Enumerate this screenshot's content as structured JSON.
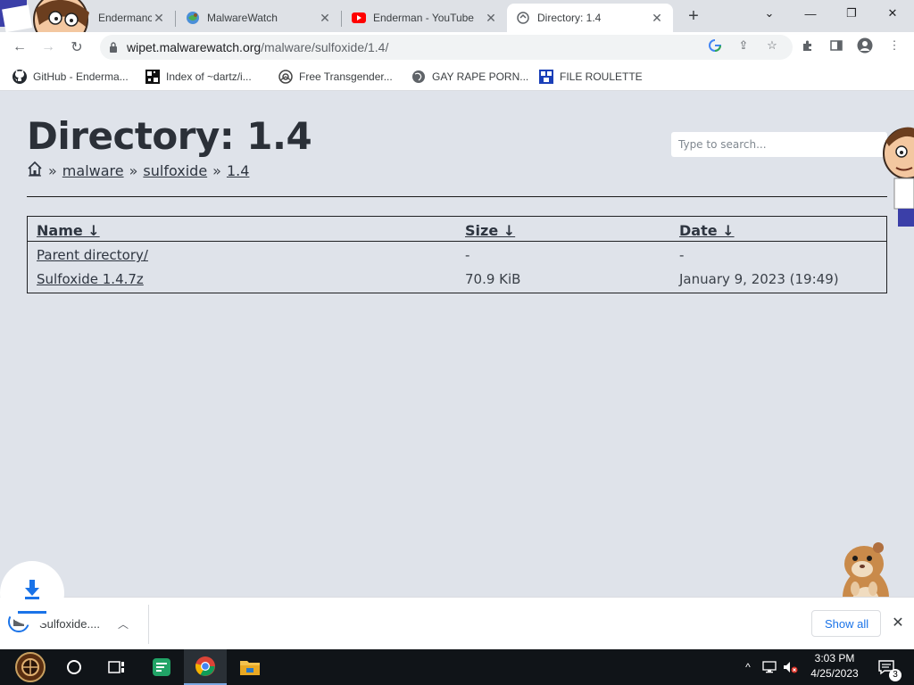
{
  "tabs": [
    {
      "title": "Endermanch",
      "icon": "person-favicon-icon",
      "active": false
    },
    {
      "title": "MalwareWatch",
      "icon": "malwarewatch-favicon-icon",
      "active": false
    },
    {
      "title": "Enderman - YouTube",
      "icon": "youtube-favicon-icon",
      "active": false
    },
    {
      "title": "Directory: 1.4",
      "icon": "directory-favicon-icon",
      "active": true
    }
  ],
  "omnibox": {
    "domain": "wipet.malwarewatch.org",
    "path": "/malware/sulfoxide/1.4/"
  },
  "bookmarks": [
    {
      "label": "GitHub - Enderma...",
      "icon": "github-icon"
    },
    {
      "label": "Index of ~dartz/i...",
      "icon": "index-favicon-icon"
    },
    {
      "label": "Free Transgender...",
      "icon": "spiral-favicon-icon"
    },
    {
      "label": "GAY RAPE PORN...",
      "icon": "globe-icon"
    },
    {
      "label": "FILE ROULETTE",
      "icon": "file-roulette-favicon-icon"
    }
  ],
  "page": {
    "title": "Directory: 1.4",
    "breadcrumb": {
      "home_icon": "home-icon",
      "separator": "»",
      "items": [
        "malware",
        "sulfoxide",
        "1.4"
      ]
    },
    "search_placeholder": "Type to search...",
    "table": {
      "headers": {
        "name": "Name ↓",
        "size": "Size ↓",
        "date": "Date ↓"
      },
      "rows": [
        {
          "name": "Parent directory/",
          "size": "-",
          "date": "-"
        },
        {
          "name": "Sulfoxide 1.4.7z",
          "size": "70.9 KiB",
          "date": "January 9, 2023 (19:49)"
        }
      ]
    }
  },
  "downloads": {
    "item_name": "Sulfoxide....",
    "show_all": "Show all"
  },
  "taskbar": {
    "time": "3:03 PM",
    "date": "4/25/2023",
    "notification_count": "3"
  },
  "colors": {
    "page_bg": "#dfe3ea",
    "text_dark": "#2b3038",
    "accent_blue": "#1a73e8",
    "youtube_red": "#ff0000",
    "taskbar_bg": "#101418"
  }
}
